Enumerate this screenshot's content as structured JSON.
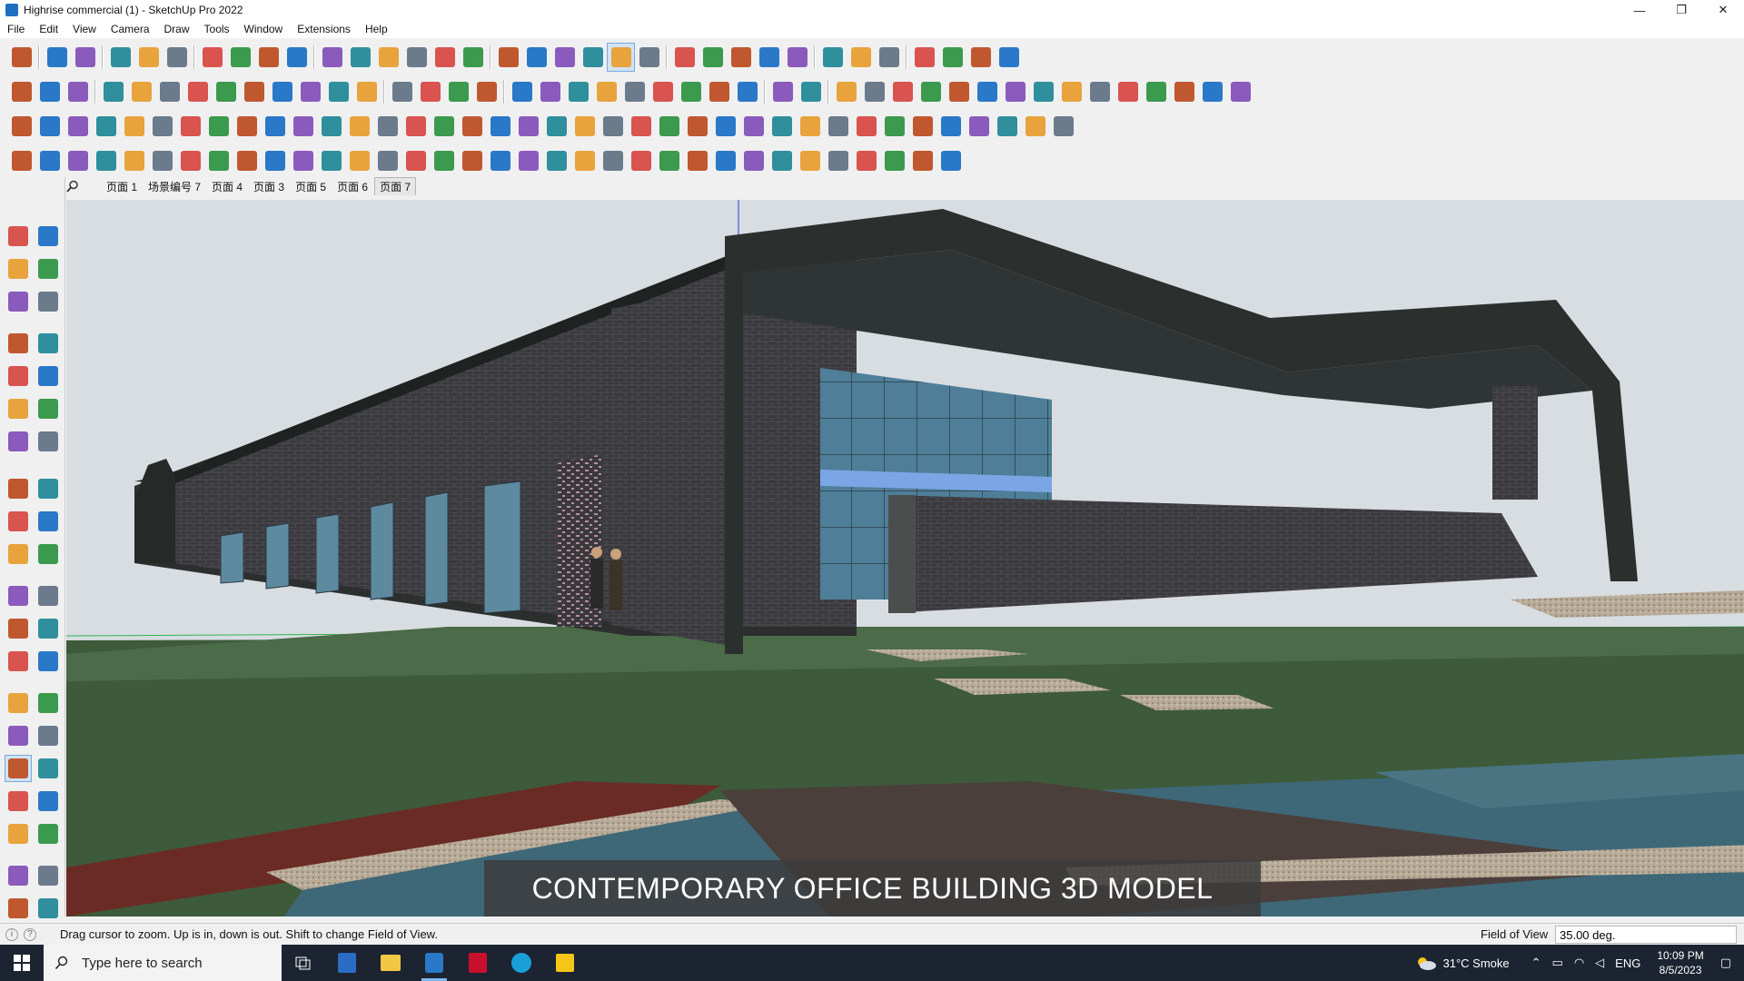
{
  "window": {
    "title": "Highrise commercial (1) - SketchUp Pro 2022",
    "minimize_label": "—",
    "restore_label": "❐",
    "close_label": "✕"
  },
  "menu": [
    "File",
    "Edit",
    "View",
    "Camera",
    "Draw",
    "Tools",
    "Window",
    "Extensions",
    "Help"
  ],
  "scenes": {
    "search_icon": "search-icon",
    "tabs": [
      "页面 1",
      "场景编号 7",
      "页面 4",
      "页面 3",
      "页面 5",
      "页面 6",
      "页面 7"
    ],
    "active_index": 6
  },
  "viewport": {
    "caption": "CONTEMPORARY OFFICE BUILDING 3D MODEL"
  },
  "status": {
    "hint": "Drag cursor to zoom.  Up is in, down is out. Shift to change Field of View.",
    "vcb_label": "Field of View",
    "vcb_value": "35.00 deg."
  },
  "taskbar": {
    "search_placeholder": "Type here to search",
    "weather": "31°C  Smoke",
    "language": "ENG",
    "time": "10:09 PM",
    "date": "8/5/2023"
  },
  "colors": {
    "brick": "#3b3a3e",
    "sky": "#d9dee3",
    "water": "#3e6a7a",
    "grass": "#3f5a3c",
    "path": "#6b2c24",
    "glass": "#5b8aa6",
    "roof": "#2e3432",
    "accent": "#2a78c8"
  }
}
